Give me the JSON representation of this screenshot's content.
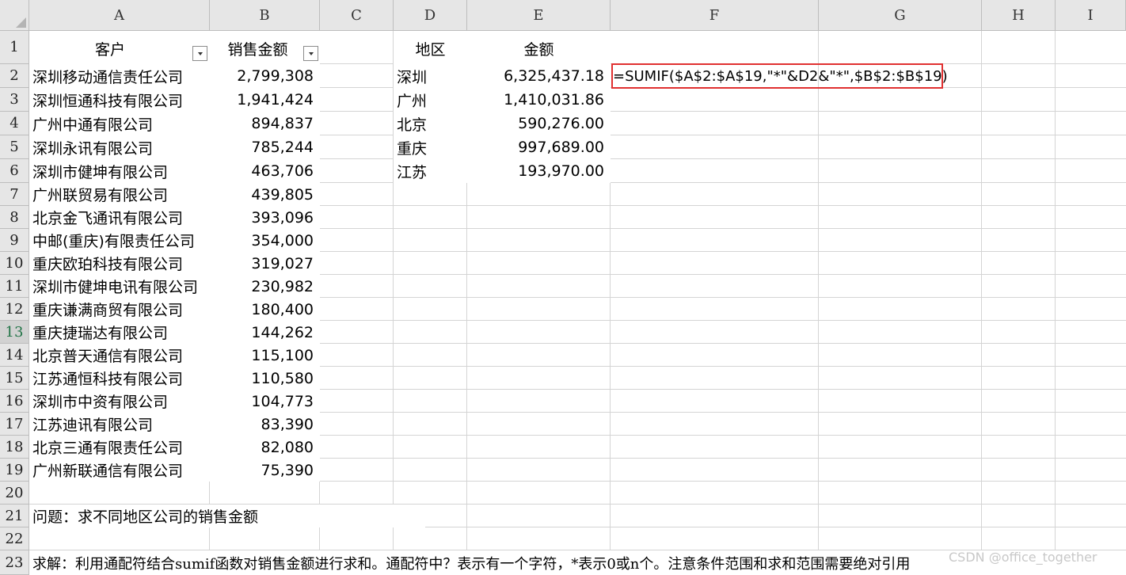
{
  "columns": [
    "A",
    "B",
    "C",
    "D",
    "E",
    "F",
    "G",
    "H",
    "I"
  ],
  "rows": [
    "1",
    "2",
    "3",
    "4",
    "5",
    "6",
    "7",
    "8",
    "9",
    "10",
    "11",
    "12",
    "13",
    "14",
    "15",
    "16",
    "17",
    "18",
    "19",
    "20",
    "21",
    "22",
    "23"
  ],
  "active_row": "13",
  "header": {
    "customer": "客户",
    "sales": "销售金额",
    "region": "地区",
    "amount": "金额"
  },
  "customers": [
    {
      "name": "深圳移动通信责任公司",
      "sales": "2,799,308"
    },
    {
      "name": "深圳恒通科技有限公司",
      "sales": "1,941,424"
    },
    {
      "name": "广州中通有限公司",
      "sales": "894,837"
    },
    {
      "name": "深圳永讯有限公司",
      "sales": "785,244"
    },
    {
      "name": "深圳市健坤有限公司",
      "sales": "463,706"
    },
    {
      "name": "广州联贸易有限公司",
      "sales": "439,805"
    },
    {
      "name": "北京金飞通讯有限公司",
      "sales": "393,096"
    },
    {
      "name": "中邮(重庆)有限责任公司",
      "sales": "354,000"
    },
    {
      "name": "重庆欧珀科技有限公司",
      "sales": "319,027"
    },
    {
      "name": "深圳市健坤电讯有限公司",
      "sales": "230,982"
    },
    {
      "name": "重庆谦满商贸有限公司",
      "sales": "180,400"
    },
    {
      "name": "重庆捷瑞达有限公司",
      "sales": "144,262"
    },
    {
      "name": "北京普天通信有限公司",
      "sales": "115,100"
    },
    {
      "name": "江苏通恒科技有限公司",
      "sales": "110,580"
    },
    {
      "name": "深圳市中资有限公司",
      "sales": "104,773"
    },
    {
      "name": "江苏迪讯有限公司",
      "sales": "83,390"
    },
    {
      "name": "北京三通有限责任公司",
      "sales": "82,080"
    },
    {
      "name": "广州新联通信有限公司",
      "sales": "75,390"
    }
  ],
  "regions": [
    {
      "name": "深圳",
      "amount": "6,325,437.18"
    },
    {
      "name": "广州",
      "amount": "1,410,031.86"
    },
    {
      "name": "北京",
      "amount": "590,276.00"
    },
    {
      "name": "重庆",
      "amount": "997,689.00"
    },
    {
      "name": "江苏",
      "amount": "193,970.00"
    }
  ],
  "formula": "=SUMIF($A$2:$A$19,\"*\"&D2&\"*\",$B$2:$B$19)",
  "question": "问题：求不同地区公司的销售金额",
  "solution": "求解：利用通配符结合sumif函数对销售金额进行求和。通配符中？表示有一个字符，*表示0或n个。注意条件范围和求和范围需要绝对引用",
  "watermark": "CSDN @office_together",
  "colors": {
    "highlight": "#e03030",
    "header_bg": "#e6e6e6",
    "active_row_text": "#217346"
  }
}
